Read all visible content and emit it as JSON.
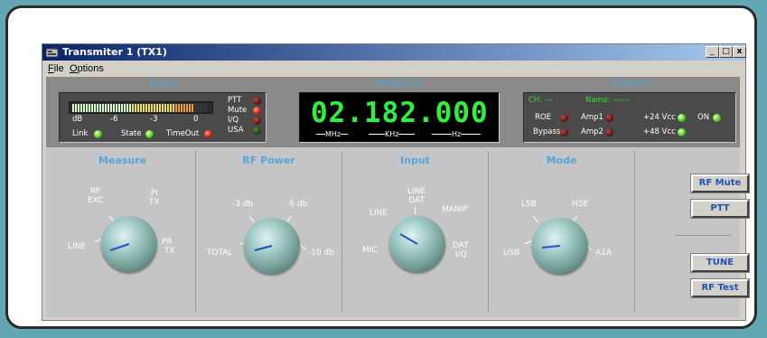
{
  "window": {
    "title": "Transmiter 1  (TX1)",
    "min_label": "_",
    "max_label": "□",
    "close_label": "x"
  },
  "menu": [
    {
      "label": "File",
      "u": "F",
      "rest": "ile"
    },
    {
      "label": "Options",
      "u": "O",
      "rest": "ptions"
    }
  ],
  "status": {
    "title": "Status",
    "scale": {
      "db": "dB",
      "m6": "-6",
      "m3": "-3",
      "zero": "0"
    },
    "vu_level": 0.9,
    "indicators": [
      {
        "label": "PTT",
        "state": "dark-red"
      },
      {
        "label": "Mute",
        "state": "red"
      },
      {
        "label": "I/Q",
        "state": "dark-red"
      },
      {
        "label": "USA",
        "state": "dark-green"
      }
    ],
    "bottom": [
      {
        "label": "Link",
        "state": "green"
      },
      {
        "label": "State",
        "state": "green"
      },
      {
        "label": "TimeOut",
        "state": "red"
      }
    ]
  },
  "frequency": {
    "title": "Frequency",
    "value": "02.182.000",
    "units": [
      "MHz",
      "KHz",
      "Hz"
    ]
  },
  "channel": {
    "title": "Channel",
    "ch": "CH: ---",
    "name": "Name: ------",
    "leds": [
      {
        "label": "ROE",
        "state": "dark-red"
      },
      {
        "label": "Amp1",
        "state": "dark-red"
      },
      {
        "label": "+24 Vcc",
        "state": "green"
      },
      {
        "label": "ON",
        "state": "green"
      },
      {
        "label": "Bypass",
        "state": "dark-red"
      },
      {
        "label": "Amp2",
        "state": "dark-red"
      },
      {
        "label": "+48 Vcc",
        "state": "green"
      }
    ]
  },
  "measure": {
    "title": "Measure",
    "labels": {
      "rf": "RF",
      "exc": "EXC",
      "pi": "PI",
      "tx1": "TX",
      "line": "LINE",
      "pr": "PR",
      "tx2": "TX"
    }
  },
  "rfpower": {
    "title": "RF Power",
    "labels": {
      "a": "-3 db",
      "b": "-6 db",
      "c": "TOTAL",
      "d": "-10 db"
    }
  },
  "input": {
    "title": "Input",
    "labels": {
      "linedat1": "LINE",
      "linedat2": "DAT",
      "manip": "MANIP",
      "line": "LINE",
      "mic": "MIC",
      "datiq1": "DAT",
      "datiq2": "I/Q"
    }
  },
  "mode": {
    "title": "Mode",
    "labels": {
      "lsb": "LSB",
      "h3e": "H3E",
      "usb": "USB",
      "a1a": "A1A"
    }
  },
  "buttons": {
    "rf_mute": "RF Mute",
    "ptt": "PTT",
    "tune": "TUNE",
    "rf_test": "RF Test"
  },
  "colors": {
    "accent": "#54a6da",
    "led_green": "#48c818",
    "led_red": "#c81a0a",
    "display_green": "#2ef23a"
  }
}
